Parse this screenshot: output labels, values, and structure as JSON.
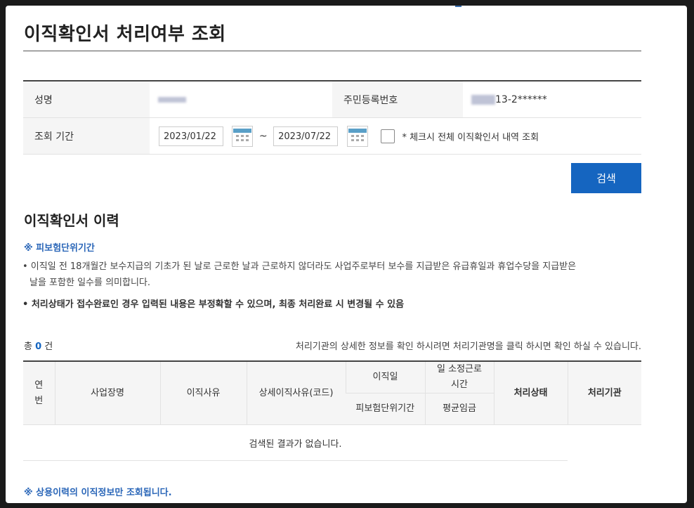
{
  "page": {
    "title": "이직확인서 처리여부 조회"
  },
  "info": {
    "name_label": "성명",
    "rrn_label": "주민등록번호",
    "rrn_value": "13-2******",
    "period_label": "조회 기간",
    "start_date": "2023/01/22",
    "end_date": "2023/07/22",
    "range_sep": "~",
    "check_all_label": "* 체크시 전체 이직확인서 내역 조회",
    "check_all_checked": false
  },
  "search_button": "검색",
  "history": {
    "title": "이직확인서 이력",
    "note_heading": "※ 피보험단위기간",
    "bullet1_line1": "• 이직일 전 18개월간 보수지급의 기초가 된 날로 근로한 날과 근로하지 않더라도 사업주로부터 보수를 지급받은 유급휴일과 휴업수당을 지급받은",
    "bullet1_line2": "날을 포함한 일수를 의미합니다.",
    "bullet2": "• 처리상태가 접수완료인 경우 입력된 내용은 부정확할 수 있으며, 최종 처리완료 시 변경될 수 있음",
    "count_prefix": "총",
    "count_value": "0",
    "count_suffix": "건",
    "help_text": "처리기관의 상세한 정보를 확인 하시려면 처리기관명을 클릭 하시면 확인 하실 수 있습니다."
  },
  "table": {
    "col_no_1": "연",
    "col_no_2": "번",
    "col_company": "사업장명",
    "col_reason": "이직사유",
    "col_detail_reason": "상세이직사유(코드)",
    "col_leave_date": "이직일",
    "col_period": "피보험단위기간",
    "col_hours_1": "일 소정근로",
    "col_hours_2": "시간",
    "col_avg_wage": "평균임금",
    "col_status": "처리상태",
    "col_agency": "처리기관",
    "empty_message": "검색된 결과가 없습니다."
  },
  "footer_note": "※ 상용이력의 이직정보만 조회됩니다.",
  "colors": {
    "primary": "#1565c0",
    "note": "#2a66b8"
  }
}
